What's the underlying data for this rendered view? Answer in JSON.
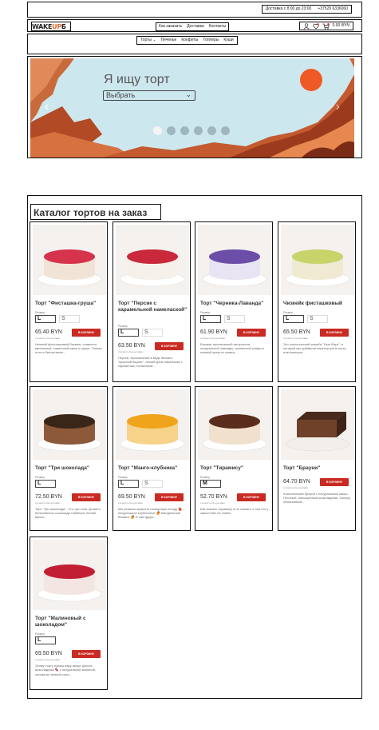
{
  "topbar": {
    "hours": "Доставка с 8:00 до 23:00",
    "phone": "+37529 6336060"
  },
  "header": {
    "logo_main": "WAKE",
    "logo_accent": "UP",
    "logo_tail": "Б",
    "nav": [
      "Как заказать",
      "Доставка",
      "Контакты"
    ],
    "cart_total": "0.00 BYN"
  },
  "categories": [
    "Торты ⌄",
    "Печенье",
    "Конфеты",
    "Топперы",
    "Куши"
  ],
  "hero": {
    "title": "Я ищу торт",
    "select_value": "Выбрать",
    "slides": 6,
    "active_slide": 0
  },
  "catalog": {
    "title": "Каталог тортов на заказ",
    "size_label": "Размер",
    "price_note": "стоимость без доставки",
    "cart_button": "В КОРЗИНУ",
    "products": [
      {
        "name": "Торт \"Фисташка-груша\"",
        "sizes": [
          "L",
          "S"
        ],
        "price": "65.40 BYN",
        "desc": "Нежный фисташковый бисквит, сливочно-ванильный, сливочный крем и груша. Тонкая нота в белом мине..."
      },
      {
        "name": "Торт \"Персик с карамельной намелаской\"",
        "sizes": [
          "L",
          "S"
        ],
        "price": "63.50 BYN",
        "desc": "Персик, выложенный в виде бисквит \"красный бархат\", легкий крем намеласка с карамелью, сливочный..."
      },
      {
        "name": "Торт \"Черника-Лаванда\"",
        "sizes": [
          "L",
          "S"
        ],
        "price": "61.90 BYN",
        "desc": "Бисквит пропитанный экстрактом натуральной лаванды, черничный конфи и нежный крем из сливок ..."
      },
      {
        "name": "Чизкейк фисташковый",
        "sizes": [
          "L",
          "S"
        ],
        "price": "65.50 BYN",
        "desc": "Это классический чизкейк \"Нью-Йорк\", в который мы добавили перетертую в пасту итальянскую..."
      },
      {
        "name": "Торт \"Три шоколада\"",
        "sizes": [
          "L"
        ],
        "price": "72.50 BYN",
        "desc": "Торт \"Три шоколада\" - это три слоя лучшего бельгийского шоколада Callebaut: белый, ванил..."
      },
      {
        "name": "Торт \"Манго-клубника\"",
        "sizes": [
          "L",
          "S"
        ],
        "price": "69.50 BYN",
        "desc": "Мы решили скрасить пасмурную погоду 🍓 - натуральное клубничное 🥭 Миндальный бисквит 🥭 И сам фрукт..."
      },
      {
        "name": "Торт \"Тирамису\"",
        "sizes": [
          "M"
        ],
        "price": "52.70 BYN",
        "desc": "Как сказать тирамису и не сказать о том что у зашел! Мы не знаем."
      },
      {
        "name": "Торт \"Брауни\"",
        "sizes": [],
        "price": "64.70 BYN",
        "desc": "Классический брауни с натуральным какао. Плотный, насыщенный шоколадным. Сверху обсыпанный..."
      },
      {
        "name": "Торт \"Малиновый с шоколадом\"",
        "sizes": [
          "L"
        ],
        "price": "69.50 BYN",
        "desc": "Этому торту нужны пару минут десерт-шоколадный 🍫 с натуральной малиной, основа из темной слои..."
      }
    ]
  },
  "colors": {
    "accent": "#c92a22",
    "logo_orange": "#e26b2c",
    "hero_sky": "#cde7ee",
    "hero_sun": "#ef5a24",
    "hero_mountains": "#c86a3c"
  }
}
